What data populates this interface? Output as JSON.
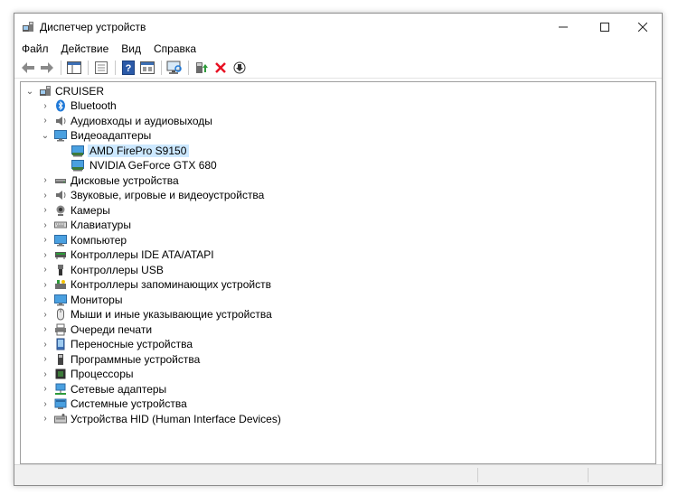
{
  "window": {
    "title": "Диспетчер устройств"
  },
  "menu": [
    {
      "label": "Файл"
    },
    {
      "label": "Действие"
    },
    {
      "label": "Вид"
    },
    {
      "label": "Справка"
    }
  ],
  "tree": {
    "root": "CRUISER",
    "categories": [
      {
        "label": "Bluetooth",
        "icon": "bluetooth-icon",
        "expanded": false
      },
      {
        "label": "Аудиовходы и аудиовыходы",
        "icon": "speaker-icon",
        "expanded": false
      },
      {
        "label": "Видеоадаптеры",
        "icon": "display-adapter-icon",
        "expanded": true,
        "children": [
          {
            "label": "AMD FirePro S9150",
            "selected": true
          },
          {
            "label": "NVIDIA GeForce GTX 680",
            "selected": false
          }
        ]
      },
      {
        "label": "Дисковые устройства",
        "icon": "disk-icon",
        "expanded": false
      },
      {
        "label": "Звуковые, игровые и видеоустройства",
        "icon": "speaker-icon",
        "expanded": false
      },
      {
        "label": "Камеры",
        "icon": "camera-icon",
        "expanded": false
      },
      {
        "label": "Клавиатуры",
        "icon": "keyboard-icon",
        "expanded": false
      },
      {
        "label": "Компьютер",
        "icon": "monitor-icon",
        "expanded": false
      },
      {
        "label": "Контроллеры IDE ATA/ATAPI",
        "icon": "ide-controller-icon",
        "expanded": false
      },
      {
        "label": "Контроллеры USB",
        "icon": "usb-icon",
        "expanded": false
      },
      {
        "label": "Контроллеры запоминающих устройств",
        "icon": "storage-controller-icon",
        "expanded": false
      },
      {
        "label": "Мониторы",
        "icon": "monitor-icon",
        "expanded": false
      },
      {
        "label": "Мыши и иные указывающие устройства",
        "icon": "mouse-icon",
        "expanded": false
      },
      {
        "label": "Очереди печати",
        "icon": "printer-icon",
        "expanded": false
      },
      {
        "label": "Переносные устройства",
        "icon": "portable-device-icon",
        "expanded": false
      },
      {
        "label": "Программные устройства",
        "icon": "software-device-icon",
        "expanded": false
      },
      {
        "label": "Процессоры",
        "icon": "processor-icon",
        "expanded": false
      },
      {
        "label": "Сетевые адаптеры",
        "icon": "network-adapter-icon",
        "expanded": false
      },
      {
        "label": "Системные устройства",
        "icon": "system-device-icon",
        "expanded": false
      },
      {
        "label": "Устройства HID (Human Interface Devices)",
        "icon": "hid-icon",
        "expanded": false
      }
    ]
  },
  "colors": {
    "selection": "#cce8ff",
    "accent": "#1e78d7",
    "uninstall": "#e81123",
    "enable": "#2e9b3a"
  }
}
